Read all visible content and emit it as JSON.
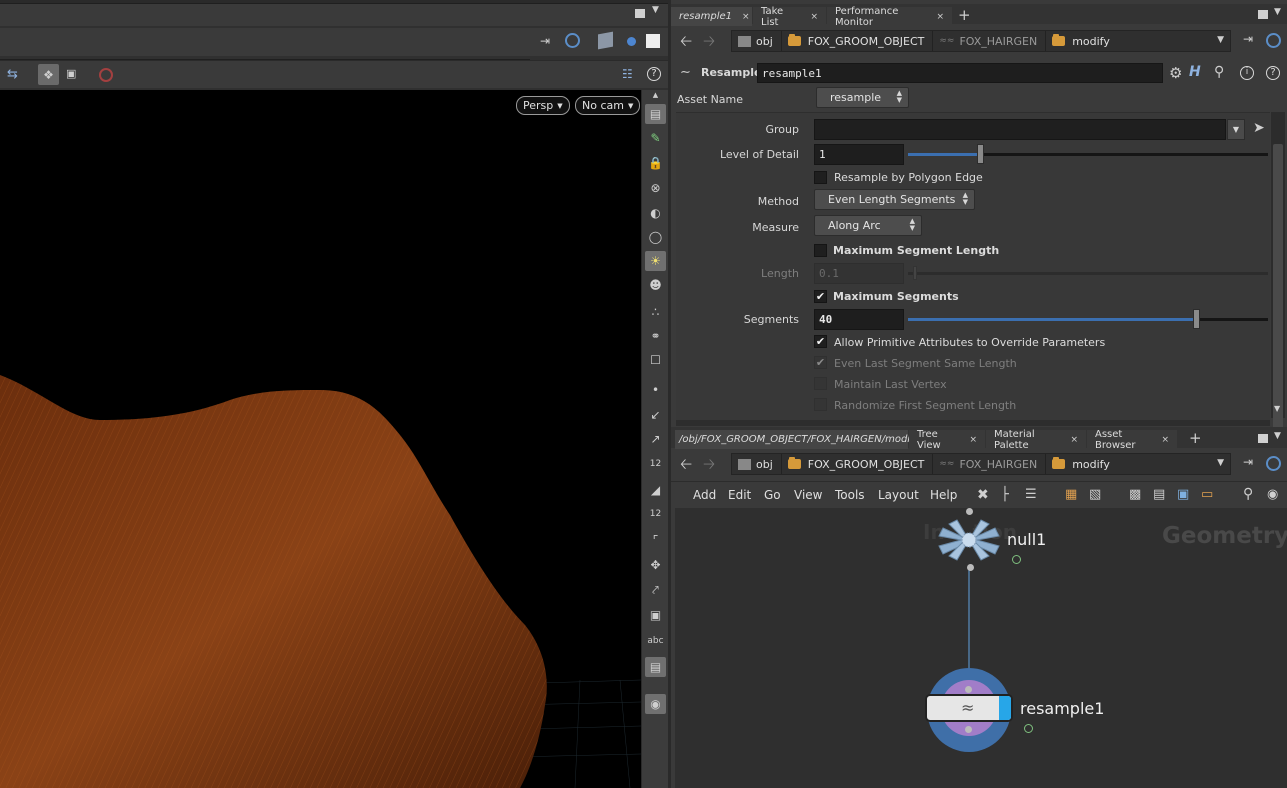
{
  "viewport": {
    "persp_label": "Persp",
    "cam_label": "No cam",
    "abc_label": "abc",
    "tools_left": [
      "12",
      "12"
    ]
  },
  "param_pane": {
    "tabs": [
      {
        "label": "resample1",
        "active": true
      },
      {
        "label": "Take List",
        "active": false
      },
      {
        "label": "Performance Monitor",
        "active": false
      }
    ],
    "path": [
      "obj",
      "FOX_GROOM_OBJECT",
      "FOX_HAIRGEN",
      "modify"
    ],
    "node_type": "Resample",
    "node_name": "resample1",
    "asset_name_label": "Asset Name",
    "asset_name_value": "resample",
    "group_label": "Group",
    "group_value": "",
    "lod_label": "Level of Detail",
    "lod_value": "1",
    "lod_fraction": 0.2,
    "resample_poly_edge": "Resample by Polygon Edge",
    "method_label": "Method",
    "method_value": "Even Length Segments",
    "measure_label": "Measure",
    "measure_value": "Along Arc",
    "max_seg_length_label": "Maximum Segment Length",
    "length_label": "Length",
    "length_value": "0.1",
    "max_segments_label": "Maximum Segments",
    "segments_label": "Segments",
    "segments_value": "40",
    "segments_fraction": 0.8,
    "allow_prim_attrs": "Allow Primitive Attributes to Override Parameters",
    "even_last_segment": "Even Last Segment Same Length",
    "maintain_last_vertex": "Maintain Last Vertex",
    "randomize_first": "Randomize First Segment Length"
  },
  "network_pane": {
    "tabs": [
      {
        "label": "/obj/FOX_GROOM_OBJECT/FOX_HAIRGEN/modify",
        "active": true
      },
      {
        "label": "Tree View",
        "active": false
      },
      {
        "label": "Material Palette",
        "active": false
      },
      {
        "label": "Asset Browser",
        "active": false
      }
    ],
    "path": [
      "obj",
      "FOX_GROOM_OBJECT",
      "FOX_HAIRGEN",
      "modify"
    ],
    "menus": [
      "Add",
      "Edit",
      "Go",
      "View",
      "Tools",
      "Layout",
      "Help"
    ],
    "watermark_left": "In    tion",
    "watermark_right": "Geometry",
    "nodes": [
      {
        "name": "null1"
      },
      {
        "name": "resample1"
      }
    ]
  },
  "colors": {
    "accent_blue": "#3b6fb0",
    "folder_orange": "#d69a3a",
    "hair_brown": "#7a3a12"
  }
}
